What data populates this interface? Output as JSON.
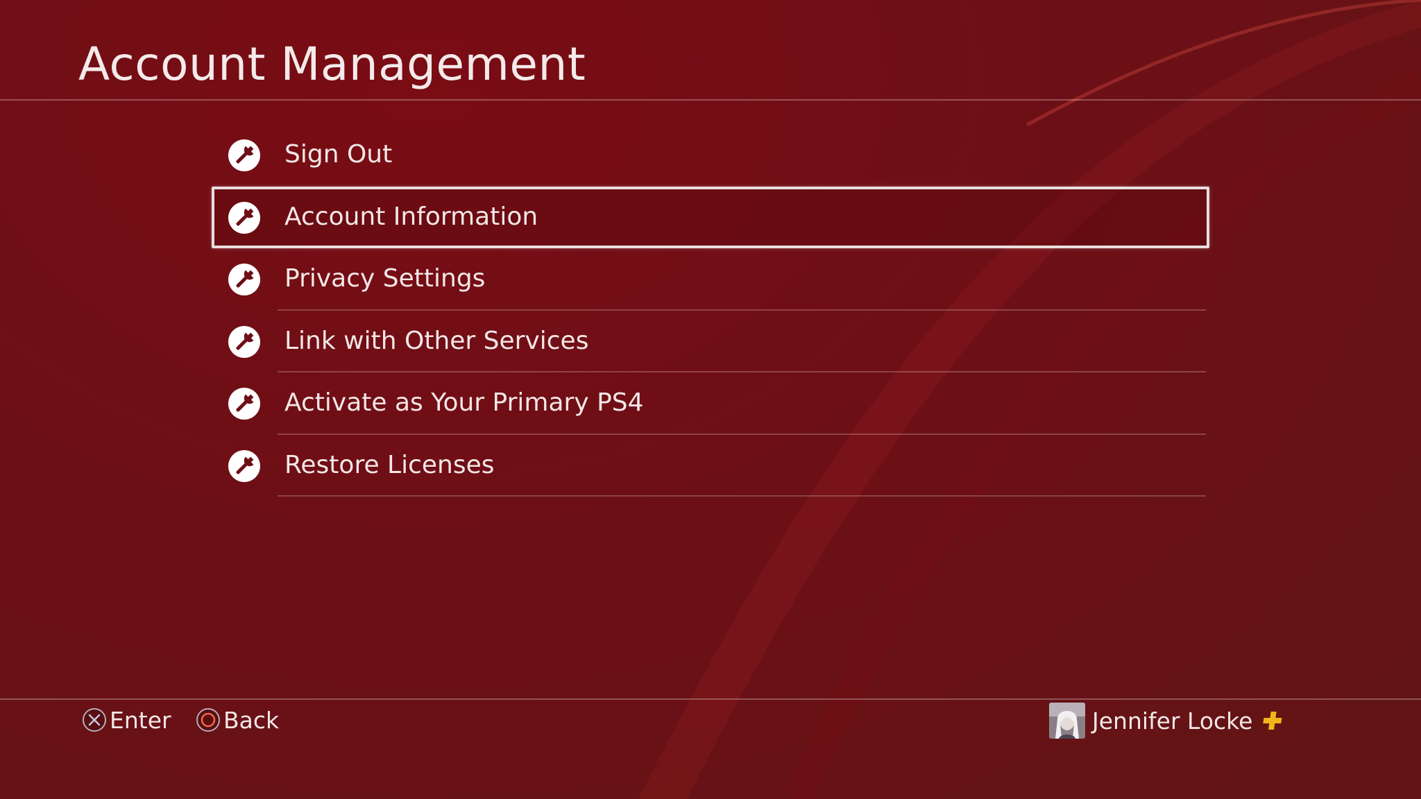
{
  "page": {
    "title": "Account Management"
  },
  "menu": {
    "items": [
      {
        "label": "Sign Out",
        "icon": "wrench-icon",
        "selected": false
      },
      {
        "label": "Account Information",
        "icon": "wrench-icon",
        "selected": true
      },
      {
        "label": "Privacy Settings",
        "icon": "wrench-icon",
        "selected": false
      },
      {
        "label": "Link with Other Services",
        "icon": "wrench-icon",
        "selected": false
      },
      {
        "label": "Activate as Your Primary PS4",
        "icon": "wrench-icon",
        "selected": false
      },
      {
        "label": "Restore Licenses",
        "icon": "wrench-icon",
        "selected": false
      }
    ]
  },
  "footer": {
    "enter_label": "Enter",
    "back_label": "Back",
    "enter_icon": "cross-button-icon",
    "back_icon": "circle-button-icon",
    "user_name": "Jennifer Locke",
    "plus_icon": "ps-plus-icon"
  },
  "colors": {
    "background": "#6d0f16",
    "text": "#f3e7e7",
    "plus": "#f2b418"
  }
}
